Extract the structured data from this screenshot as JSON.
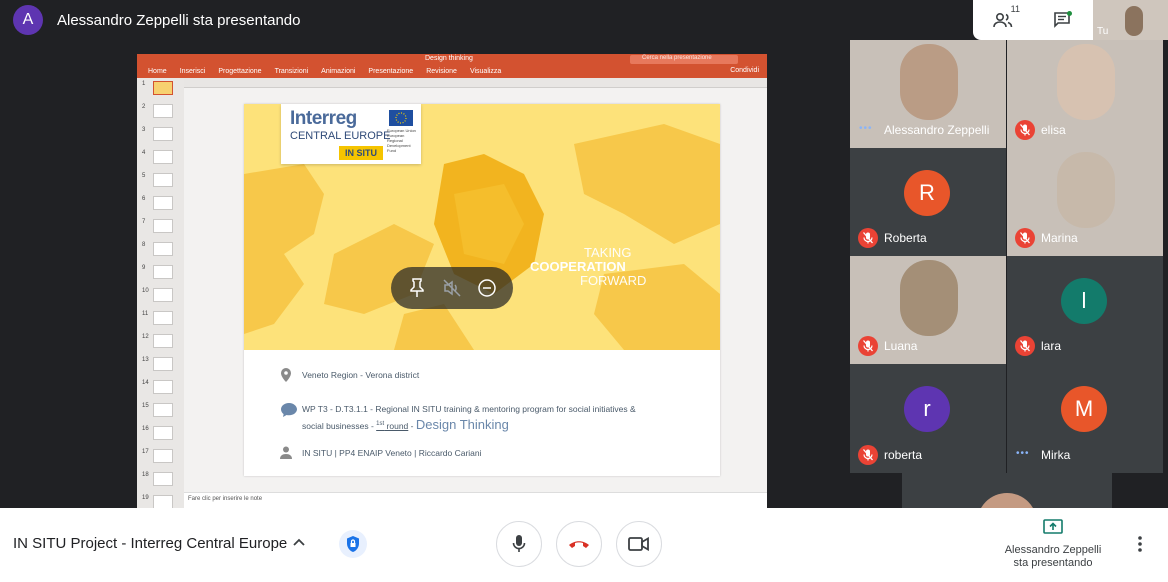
{
  "presenter": {
    "avatar_letter": "A",
    "text": "Alessandro Zeppelli sta presentando"
  },
  "top_right": {
    "participants_count": "11",
    "self_label": "Tu"
  },
  "powerpoint": {
    "doc_title": "Design thinking",
    "search_placeholder": "Cerca nella presentazione",
    "tabs": [
      "Home",
      "Inserisci",
      "Progettazione",
      "Transizioni",
      "Animazioni",
      "Presentazione",
      "Revisione",
      "Visualizza"
    ],
    "share_label": "Condividi",
    "thumb_numbers": [
      "1",
      "2",
      "3",
      "4",
      "5",
      "6",
      "7",
      "8",
      "9",
      "10",
      "11",
      "12",
      "13",
      "14",
      "15",
      "16",
      "17",
      "18",
      "19"
    ],
    "notes_placeholder": "Fare clic per inserire le note"
  },
  "slide": {
    "logo_title": "Interreg",
    "logo_sub": "CENTRAL EUROPE",
    "logo_tag": "IN SITU",
    "logo_flag_text": "European Union European Regional Development Fund",
    "tagline_1": "TAKING",
    "tagline_2": "COOPERATION",
    "tagline_3": "FORWARD",
    "location": "Veneto Region - Verona district",
    "wp_line1": "WP T3 - D.T3.1.1 - Regional IN SITU training & mentoring program for social initiatives &",
    "wp_line2_a": "social businesses - ",
    "wp_round_sup": "1st",
    "wp_round": " round",
    "wp_line2_b": " - ",
    "wp_design": "Design Thinking",
    "partners": "IN SITU | PP4 ENAIP Veneto | Riccardo Cariani"
  },
  "participants": [
    {
      "name": "Alessandro Zeppelli",
      "muted": false,
      "video": true
    },
    {
      "name": "elisa",
      "muted": true,
      "video": true
    },
    {
      "name": "Roberta",
      "muted": true,
      "video": false,
      "initial": "R",
      "color": "#e8562a"
    },
    {
      "name": "Marina",
      "muted": true,
      "video": true
    },
    {
      "name": "Luana",
      "muted": true,
      "video": true
    },
    {
      "name": "lara",
      "muted": true,
      "video": false,
      "initial": "l",
      "color": "#137b6b"
    },
    {
      "name": "roberta",
      "muted": true,
      "video": false,
      "initial": "r",
      "color": "#5e35b1"
    },
    {
      "name": "Mirka",
      "muted": false,
      "video": false,
      "initial": "M",
      "color": "#e8562a"
    }
  ],
  "bottom": {
    "meeting_name": "IN SITU Project - Interreg Central Europe",
    "present_label_1": "Alessandro Zeppelli",
    "present_label_2": "sta presentando"
  },
  "colors": {
    "ppt_accent": "#d35230",
    "mute_red": "#ea4335",
    "meet_bg": "#202124"
  }
}
